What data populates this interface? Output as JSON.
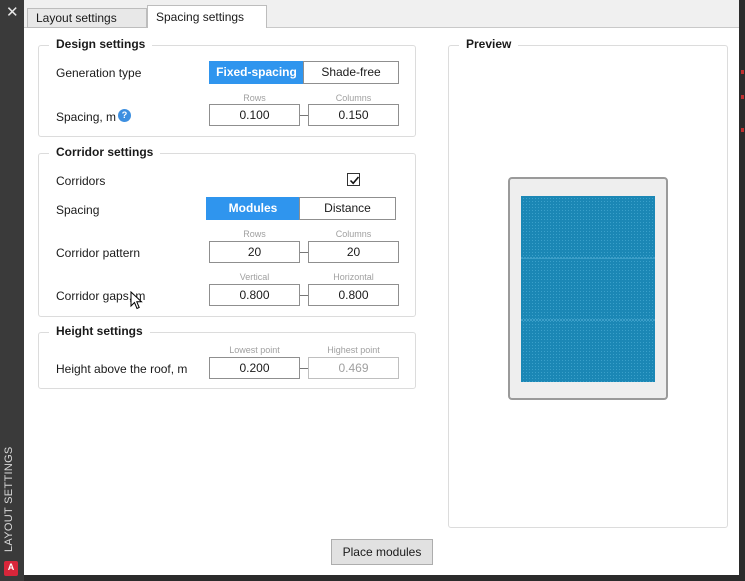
{
  "window": {
    "side_title": "LAYOUT SETTINGS",
    "close_glyph": "✕",
    "logo_letter": "A"
  },
  "tabs": [
    {
      "label": "Layout settings"
    },
    {
      "label": "Spacing settings"
    }
  ],
  "design": {
    "title": "Design settings",
    "generation_type_label": "Generation type",
    "generation_options": [
      "Fixed-spacing",
      "Shade-free"
    ],
    "generation_selected": "Fixed-spacing",
    "spacing_label": "Spacing, m",
    "help_glyph": "?",
    "rows_label": "Rows",
    "columns_label": "Columns",
    "rows_value": "0.100",
    "columns_value": "0.150"
  },
  "corridor": {
    "title": "Corridor settings",
    "corridors_label": "Corridors",
    "corridors_checked": true,
    "spacing_label": "Spacing",
    "spacing_options": [
      "Modules",
      "Distance"
    ],
    "spacing_selected": "Modules",
    "pattern_label": "Corridor pattern",
    "rows_label": "Rows",
    "columns_label": "Columns",
    "pattern_rows": "20",
    "pattern_columns": "20",
    "gaps_label": "Corridor gaps, m",
    "vertical_label": "Vertical",
    "horizontal_label": "Horizontal",
    "gap_vertical": "0.800",
    "gap_horizontal": "0.800"
  },
  "height": {
    "title": "Height settings",
    "above_roof_label": "Height above the roof, m",
    "lowest_label": "Lowest point",
    "highest_label": "Highest point",
    "lowest_value": "0.200",
    "highest_value": "0.469"
  },
  "preview": {
    "title": "Preview",
    "module_color": "#1b87b5",
    "roof_color": "#eeeeee"
  },
  "actions": {
    "place_modules": "Place modules"
  }
}
